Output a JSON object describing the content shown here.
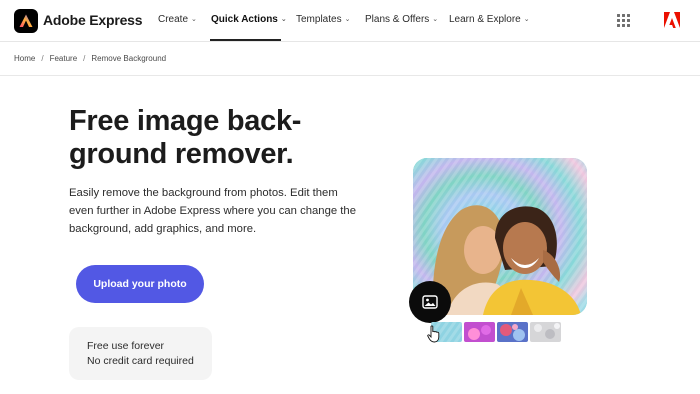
{
  "brand": {
    "name": "Adobe Express"
  },
  "nav": {
    "items": [
      {
        "label": "Create"
      },
      {
        "label": "Quick Actions"
      },
      {
        "label": "Templates"
      },
      {
        "label": "Plans & Offers"
      },
      {
        "label": "Learn & Explore"
      }
    ],
    "active": "Quick Actions"
  },
  "breadcrumb": [
    "Home",
    "Feature",
    "Remove Background"
  ],
  "hero": {
    "title_line1": "Free image back-",
    "title_line2": "ground remover.",
    "description": "Easily remove the background from photos. Edit them even further in Adobe Express where you can change the background, add graphics, and more.",
    "upload_label": "Upload your photo",
    "info_line1": "Free use forever",
    "info_line2": "No credit card required"
  },
  "icons": {
    "nav_chevron": "chevron-down-icon",
    "apps": "app-grid-icon",
    "adobe": "adobe-logo-icon",
    "image_action": "image-icon",
    "cursor": "hand-pointer-icon"
  },
  "colors": {
    "accent": "#5258e4",
    "text": "#2c2c2c",
    "adobe_red": "#eb1000",
    "info_card_bg": "#f4f4f4"
  }
}
